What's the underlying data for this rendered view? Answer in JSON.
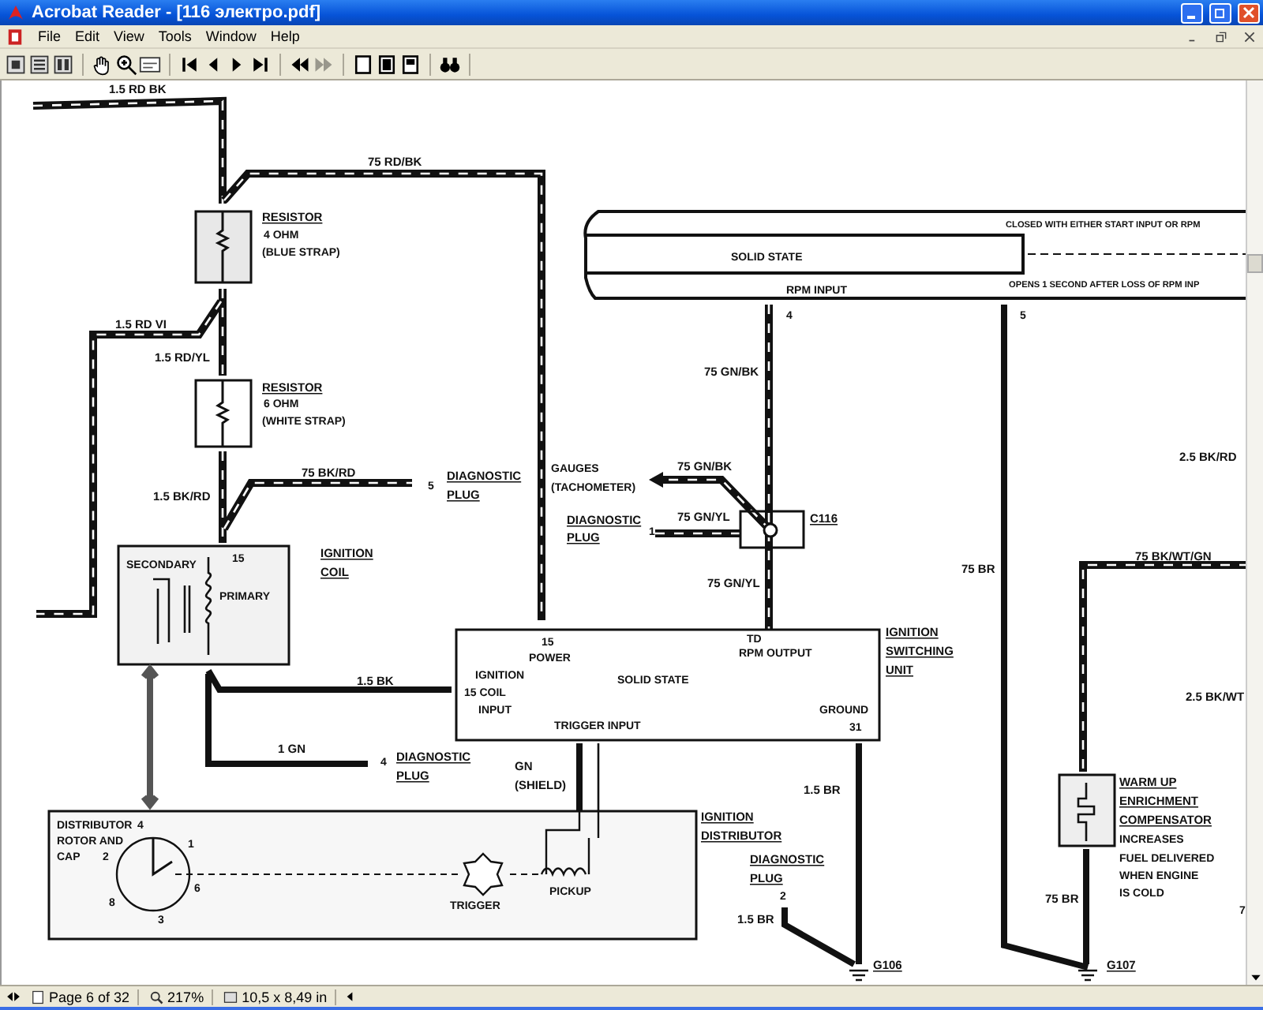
{
  "window": {
    "title": "Acrobat Reader - [116 электро.pdf]"
  },
  "menu": [
    "File",
    "Edit",
    "View",
    "Tools",
    "Window",
    "Help"
  ],
  "toolbar": [
    [
      {
        "kind": "single-page",
        "disabled": false
      },
      {
        "kind": "continuous",
        "disabled": false
      },
      {
        "kind": "facing",
        "disabled": false
      }
    ],
    [
      {
        "kind": "hand",
        "disabled": false
      },
      {
        "kind": "zoom",
        "disabled": false
      },
      {
        "kind": "text-select",
        "disabled": false
      }
    ],
    [
      {
        "kind": "first",
        "disabled": false
      },
      {
        "kind": "prev",
        "disabled": false
      },
      {
        "kind": "next",
        "disabled": false
      },
      {
        "kind": "last",
        "disabled": false
      }
    ],
    [
      {
        "kind": "back",
        "disabled": false
      },
      {
        "kind": "forward",
        "disabled": true
      }
    ],
    [
      {
        "kind": "actual-size",
        "disabled": false
      },
      {
        "kind": "fit-page",
        "disabled": false
      },
      {
        "kind": "fit-width",
        "disabled": false
      }
    ],
    [
      {
        "kind": "find",
        "disabled": false
      }
    ]
  ],
  "diagram": {
    "labels": [
      {
        "text": "1.5 RD BK",
        "kind": "wire"
      },
      {
        "text": "75 RD/BK",
        "kind": "wire"
      },
      {
        "text": "RESISTOR",
        "kind": "component"
      },
      {
        "text": "4 OHM",
        "kind": "note"
      },
      {
        "text": "(BLUE STRAP)",
        "kind": "note"
      },
      {
        "text": "1.5 RD VI",
        "kind": "wire"
      },
      {
        "text": "1.5 RD/YL",
        "kind": "wire"
      },
      {
        "text": "RESISTOR",
        "kind": "component"
      },
      {
        "text": "6 OHM",
        "kind": "note"
      },
      {
        "text": "(WHITE STRAP)",
        "kind": "note"
      },
      {
        "text": "75 BK/RD",
        "kind": "wire"
      },
      {
        "text": "1.5 BK/RD",
        "kind": "wire"
      },
      {
        "text": "5",
        "kind": "pin"
      },
      {
        "text": "DIAGNOSTIC",
        "kind": "component"
      },
      {
        "text": "PLUG",
        "kind": "component"
      },
      {
        "text": "IGNITION",
        "kind": "component"
      },
      {
        "text": "COIL",
        "kind": "component"
      },
      {
        "text": "15",
        "kind": "pin"
      },
      {
        "text": "SECONDARY",
        "kind": "note"
      },
      {
        "text": "PRIMARY",
        "kind": "note"
      },
      {
        "text": "GAUGES",
        "kind": "note"
      },
      {
        "text": "(TACHOMETER)",
        "kind": "note"
      },
      {
        "text": "DIAGNOSTIC",
        "kind": "component"
      },
      {
        "text": "PLUG",
        "kind": "component"
      },
      {
        "text": "1",
        "kind": "pin"
      },
      {
        "text": "SOLID STATE",
        "kind": "note"
      },
      {
        "text": "RPM INPUT",
        "kind": "note"
      },
      {
        "text": "CLOSED WITH EITHER START INPUT OR RPM",
        "kind": "note"
      },
      {
        "text": "OPENS 1 SECOND AFTER LOSS OF RPM INP",
        "kind": "note"
      },
      {
        "text": "4",
        "kind": "pin"
      },
      {
        "text": "5",
        "kind": "pin"
      },
      {
        "text": "75 GN/BK",
        "kind": "wire"
      },
      {
        "text": "75 GN/BK",
        "kind": "wire"
      },
      {
        "text": "75 GN/YL",
        "kind": "wire"
      },
      {
        "text": "C116",
        "kind": "component"
      },
      {
        "text": "75 GN/YL",
        "kind": "wire"
      },
      {
        "text": "75 BR",
        "kind": "wire"
      },
      {
        "text": "2.5 BK/RD",
        "kind": "wire"
      },
      {
        "text": "75 BK/WT/GN",
        "kind": "wire"
      },
      {
        "text": "15",
        "kind": "pin"
      },
      {
        "text": "POWER",
        "kind": "note"
      },
      {
        "text": "IGNITION",
        "kind": "note"
      },
      {
        "text": "15 COIL",
        "kind": "note"
      },
      {
        "text": "INPUT",
        "kind": "note"
      },
      {
        "text": "SOLID STATE",
        "kind": "note"
      },
      {
        "text": "TD",
        "kind": "pin"
      },
      {
        "text": "RPM OUTPUT",
        "kind": "note"
      },
      {
        "text": "TRIGGER INPUT",
        "kind": "note"
      },
      {
        "text": "GROUND",
        "kind": "note"
      },
      {
        "text": "31",
        "kind": "pin"
      },
      {
        "text": "IGNITION",
        "kind": "component"
      },
      {
        "text": "SWITCHING",
        "kind": "component"
      },
      {
        "text": "UNIT",
        "kind": "component"
      },
      {
        "text": "2.5 BK/WT",
        "kind": "wire"
      },
      {
        "text": "1.5 BK",
        "kind": "wire"
      },
      {
        "text": "1 GN",
        "kind": "wire"
      },
      {
        "text": "4",
        "kind": "pin"
      },
      {
        "text": "DIAGNOSTIC",
        "kind": "component"
      },
      {
        "text": "PLUG",
        "kind": "component"
      },
      {
        "text": "GN",
        "kind": "wire"
      },
      {
        "text": "(SHIELD)",
        "kind": "wire"
      },
      {
        "text": "1.5 BR",
        "kind": "wire"
      },
      {
        "text": "IGNITION",
        "kind": "component"
      },
      {
        "text": "DISTRIBUTOR",
        "kind": "component"
      },
      {
        "text": "DIAGNOSTIC",
        "kind": "component"
      },
      {
        "text": "PLUG",
        "kind": "component"
      },
      {
        "text": "2",
        "kind": "pin"
      },
      {
        "text": "1.5 BR",
        "kind": "wire"
      },
      {
        "text": "G106",
        "kind": "component"
      },
      {
        "text": "DISTRIBUTOR",
        "kind": "note"
      },
      {
        "text": "ROTOR AND",
        "kind": "note"
      },
      {
        "text": "CAP",
        "kind": "note"
      },
      {
        "text": "4",
        "kind": "pin"
      },
      {
        "text": "1",
        "kind": "pin"
      },
      {
        "text": "2",
        "kind": "pin"
      },
      {
        "text": "6",
        "kind": "pin"
      },
      {
        "text": "8",
        "kind": "pin"
      },
      {
        "text": "3",
        "kind": "pin"
      },
      {
        "text": "TRIGGER",
        "kind": "note"
      },
      {
        "text": "PICKUP",
        "kind": "note"
      },
      {
        "text": "WARM UP",
        "kind": "component"
      },
      {
        "text": "ENRICHMENT",
        "kind": "component"
      },
      {
        "text": "COMPENSATOR",
        "kind": "component"
      },
      {
        "text": "INCREASES",
        "kind": "note"
      },
      {
        "text": "FUEL DELIVERED",
        "kind": "note"
      },
      {
        "text": "WHEN ENGINE",
        "kind": "note"
      },
      {
        "text": "IS COLD",
        "kind": "note"
      },
      {
        "text": "75 BR",
        "kind": "wire"
      },
      {
        "text": "G107",
        "kind": "component"
      },
      {
        "text": "7",
        "kind": "pin"
      }
    ]
  },
  "status_bar": {
    "page": "Page 6 of 32",
    "zoom": "217%",
    "size": "10,5 x 8,49 in"
  }
}
